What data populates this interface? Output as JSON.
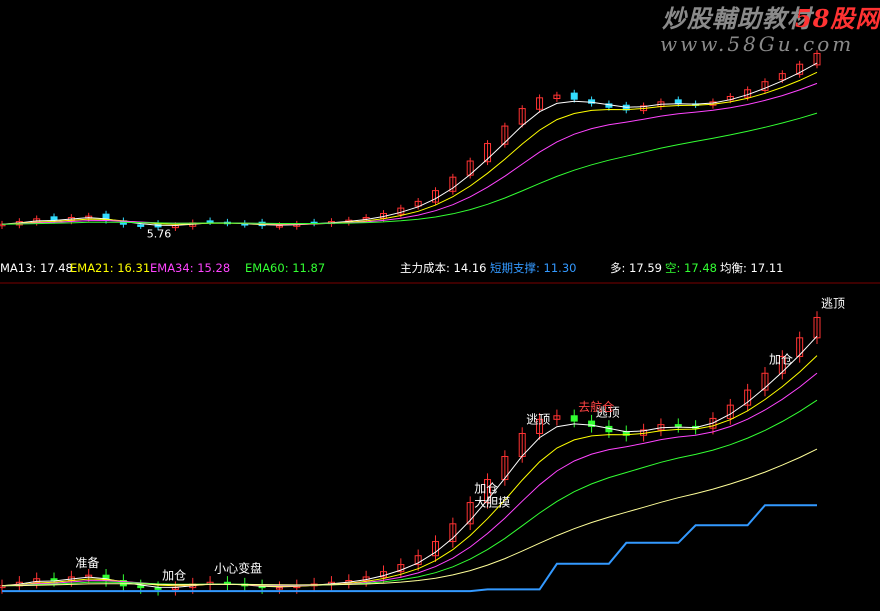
{
  "watermark": {
    "title": "炒股輔助教材",
    "brand": "58股网",
    "url": "www.58Gu.com"
  },
  "upper_legend": [
    {
      "label": "MA13: 17.48",
      "color": "#ffffff"
    },
    {
      "label": "EMA21: 16.31",
      "color": "#ffff00"
    },
    {
      "label": "EMA34: 15.28",
      "color": "#ff44ff"
    },
    {
      "label": "EMA60: 11.87",
      "color": "#33ff33"
    },
    {
      "label": "主力成本: 14.16",
      "color": "#ffffff"
    },
    {
      "label": "短期支撑: 11.30",
      "color": "#3399ff"
    },
    {
      "label": "多: 17.59",
      "color": "#ffffff"
    },
    {
      "label": "空: 17.48",
      "color": "#33ff33"
    },
    {
      "label": "均衡: 17.11",
      "color": "#ffffff"
    }
  ],
  "chart_data": {
    "type": "candlestick",
    "upper_panel": {
      "low_marker": "5.76",
      "close_trend": [
        6.3,
        6.5,
        6.7,
        6.6,
        6.8,
        6.9,
        6.6,
        6.3,
        6.2,
        6.1,
        6.2,
        6.4,
        6.5,
        6.4,
        6.3,
        6.2,
        6.2,
        6.3,
        6.4,
        6.5,
        6.6,
        6.8,
        7.1,
        7.5,
        8.0,
        8.8,
        9.8,
        11.0,
        12.3,
        13.6,
        14.9,
        15.7,
        15.9,
        15.6,
        15.3,
        15.0,
        14.8,
        15.1,
        15.4,
        15.3,
        15.2,
        15.4,
        15.8,
        16.3,
        16.9,
        17.5,
        18.2,
        19.0
      ]
    },
    "lower_panel": {
      "annotations": [
        {
          "text": "逃顶",
          "color": "#ffffff"
        },
        {
          "text": "逃顶",
          "color": "#ffffff"
        },
        {
          "text": "逃顶",
          "color": "#ffffff"
        },
        {
          "text": "加仓",
          "color": "#ffffff"
        },
        {
          "text": "加仓",
          "color": "#ffffff"
        },
        {
          "text": "加仓",
          "color": "#ffffff"
        },
        {
          "text": "大胆摸",
          "color": "#ffffff"
        },
        {
          "text": "去航仓",
          "color": "#ff4444"
        },
        {
          "text": "小心变盘",
          "color": "#ffffff"
        },
        {
          "text": "准备",
          "color": "#ffffff"
        }
      ]
    }
  }
}
